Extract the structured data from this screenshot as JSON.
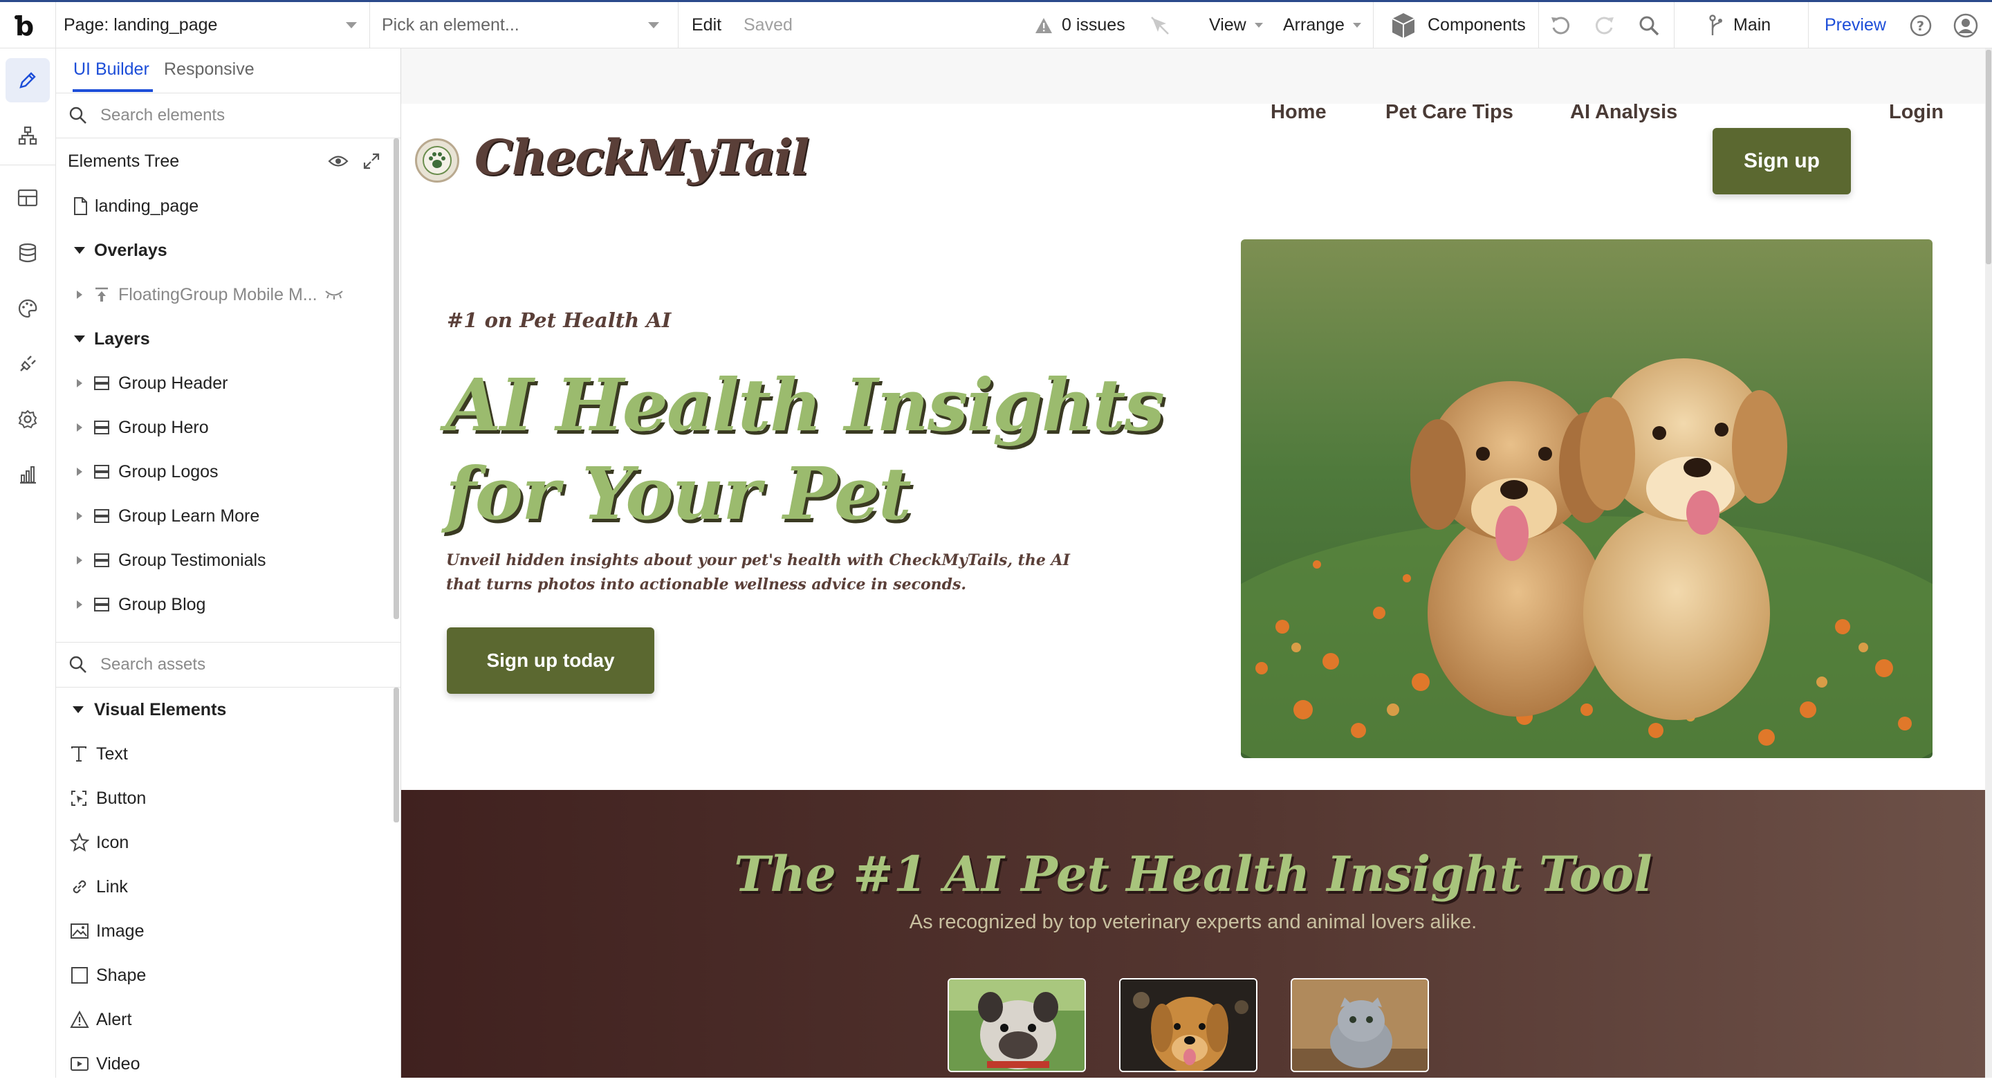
{
  "topbar": {
    "page_selector": "Page: landing_page",
    "element_picker": "Pick an element...",
    "edit": "Edit",
    "saved": "Saved",
    "issues": "0 issues",
    "view": "View",
    "arrange": "Arrange",
    "components": "Components",
    "branch": "Main",
    "preview": "Preview"
  },
  "panel": {
    "tabs": [
      "UI Builder",
      "Responsive"
    ],
    "search_elements_placeholder": "Search elements",
    "elements_tree_title": "Elements Tree",
    "root": "landing_page",
    "overlays_heading": "Overlays",
    "overlays": [
      "FloatingGroup Mobile M..."
    ],
    "layers_heading": "Layers",
    "layers": [
      "Group Header",
      "Group Hero",
      "Group Logos",
      "Group Learn More",
      "Group Testimonials",
      "Group Blog"
    ],
    "search_assets_placeholder": "Search assets",
    "visual_heading": "Visual Elements",
    "visual_elements": [
      {
        "label": "Text",
        "icon": "text-icon"
      },
      {
        "label": "Button",
        "icon": "button-icon"
      },
      {
        "label": "Icon",
        "icon": "star-icon"
      },
      {
        "label": "Link",
        "icon": "link-icon"
      },
      {
        "label": "Image",
        "icon": "image-icon"
      },
      {
        "label": "Shape",
        "icon": "shape-icon"
      },
      {
        "label": "Alert",
        "icon": "alert-icon"
      },
      {
        "label": "Video",
        "icon": "video-icon"
      }
    ]
  },
  "site": {
    "logo_text": "CheckMyTail",
    "nav": [
      "Home",
      "Pet Care Tips",
      "AI Analysis"
    ],
    "signup": "Sign up",
    "login": "Login",
    "eyebrow": "#1 on Pet Health AI",
    "hero_title_line1": "AI Health Insights",
    "hero_title_line2": "for Your Pet",
    "hero_sub": "Unveil hidden insights about your pet's health with CheckMyTails, the AI that turns photos into actionable wellness advice in seconds.",
    "cta": "Sign up today",
    "band_title": "The #1 AI Pet Health Insight Tool",
    "band_sub": "As recognized by top veterinary experts and animal lovers alike."
  },
  "colors": {
    "accent_blue": "#1d4ed8",
    "brand_green": "#5b6830",
    "hero_green": "#9bbb6e",
    "brand_brown": "#4a3b36"
  }
}
